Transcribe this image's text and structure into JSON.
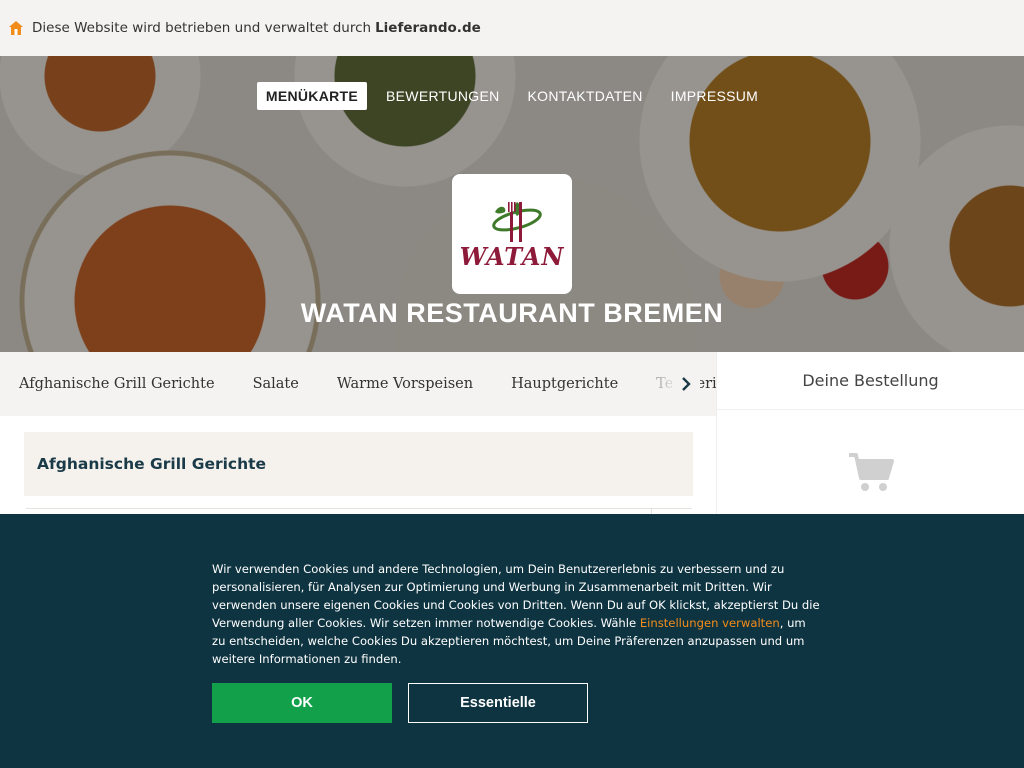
{
  "topbar": {
    "icon": "home-icon",
    "text": "Diese Website wird betrieben und verwaltet durch",
    "brand": "Lieferando.de"
  },
  "nav": {
    "items": [
      {
        "label": "MENÜKARTE",
        "active": true
      },
      {
        "label": "BEWERTUNGEN",
        "active": false
      },
      {
        "label": "KONTAKTDATEN",
        "active": false
      },
      {
        "label": "IMPRESSUM",
        "active": false
      }
    ]
  },
  "restaurant": {
    "logo_text": "WATAN",
    "name": "WATAN RESTAURANT BREMEN"
  },
  "categories": {
    "items": [
      "Afghanische Grill Gerichte",
      "Salate",
      "Warme Vorspeisen",
      "Hauptgerichte",
      "Teiggerichte"
    ],
    "next_icon": "chevron-right-icon"
  },
  "menu": {
    "section_title": "Afghanische Grill Gerichte"
  },
  "order": {
    "title": "Deine Bestellung",
    "icon": "shopping-cart-icon"
  },
  "cookie": {
    "text_before_link": "Wir verwenden Cookies und andere Technologien, um Dein Benutzererlebnis zu verbessern und zu personalisieren, für Analysen zur Optimierung und Werbung in Zusammenarbeit mit Dritten. Wir verwenden unsere eigenen Cookies und Cookies von Dritten. Wenn Du auf OK klickst, akzeptierst Du die Verwendung aller Cookies. Wir setzen immer notwendige Cookies. Wähle ",
    "link_text": "Einstellungen verwalten",
    "text_after_link": ", um zu entscheiden, welche Cookies Du akzeptieren möchtest, um Deine Präferenzen anzupassen und um weitere Informationen zu finden.",
    "ok_label": "OK",
    "essential_label": "Essentielle"
  },
  "colors": {
    "cookie_bg": "#0e3441",
    "ok_green": "#12a04b",
    "link_orange": "#f28c1a",
    "logo_red": "#8e1a3a"
  }
}
